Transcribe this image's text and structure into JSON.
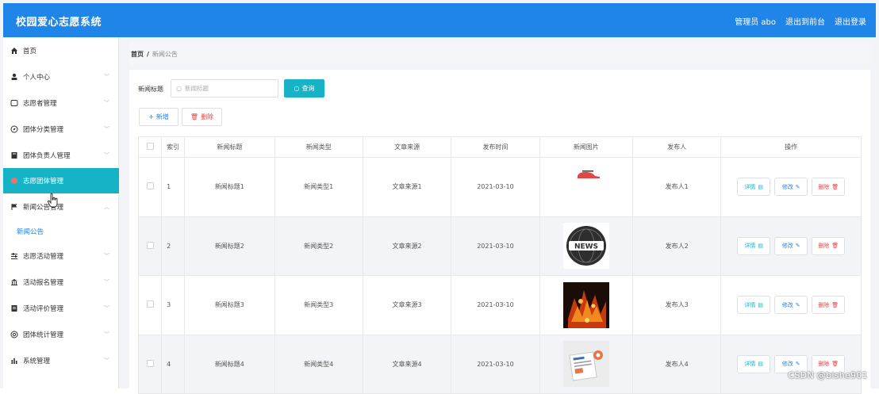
{
  "header": {
    "app_title": "校园爱心志愿系统",
    "user_label": "管理员 abo",
    "back_label": "退出到前台",
    "logout_label": "退出登录"
  },
  "sidebar": {
    "items": [
      {
        "label": "首页",
        "icon": "home-icon"
      },
      {
        "label": "个人中心",
        "icon": "user-icon"
      },
      {
        "label": "志愿者管理",
        "icon": "card-icon"
      },
      {
        "label": "团体分类管理",
        "icon": "compass-icon"
      },
      {
        "label": "团体负责人管理",
        "icon": "book-icon"
      },
      {
        "label": "志愿团体管理",
        "icon": "people-icon"
      },
      {
        "label": "新闻公告管理",
        "icon": "flag-icon"
      },
      {
        "label": "志愿活动管理",
        "icon": "sliders-icon"
      },
      {
        "label": "活动报名管理",
        "icon": "bank-icon"
      },
      {
        "label": "活动评价管理",
        "icon": "list-icon"
      },
      {
        "label": "团体统计管理",
        "icon": "globe-icon"
      },
      {
        "label": "系统管理",
        "icon": "chart-icon"
      }
    ],
    "sub_item": "新闻公告"
  },
  "breadcrumb": {
    "home": "首页",
    "separator": "/",
    "current": "新闻公告"
  },
  "search": {
    "label": "新闻标题",
    "placeholder": "新闻标题",
    "query_button": "查询"
  },
  "toolbar": {
    "add_label": "新增",
    "delete_label": "删除"
  },
  "table": {
    "headers": [
      "索引",
      "新闻标题",
      "新闻类型",
      "文章来源",
      "发布时间",
      "新闻图片",
      "发布人",
      "操作"
    ],
    "rows": [
      {
        "index": "1",
        "title": "新闻标题1",
        "type": "新闻类型1",
        "source": "文章来源1",
        "date": "2021-03-10",
        "publisher": "发布人1"
      },
      {
        "index": "2",
        "title": "新闻标题2",
        "type": "新闻类型2",
        "source": "文章来源2",
        "date": "2021-03-10",
        "publisher": "发布人2"
      },
      {
        "index": "3",
        "title": "新闻标题3",
        "type": "新闻类型3",
        "source": "文章来源3",
        "date": "2021-03-10",
        "publisher": "发布人3"
      },
      {
        "index": "4",
        "title": "新闻标题4",
        "type": "新闻类型4",
        "source": "文章来源4",
        "date": "2021-03-10",
        "publisher": "发布人4"
      }
    ],
    "actions": {
      "detail": "详情",
      "edit": "修改",
      "remove": "删除"
    },
    "image_badge": "NEWS"
  },
  "watermark": "CSDN @bishe901",
  "colors": {
    "header_bg": "#1f85e8",
    "accent": "#15b3c5",
    "danger": "#e64242"
  }
}
